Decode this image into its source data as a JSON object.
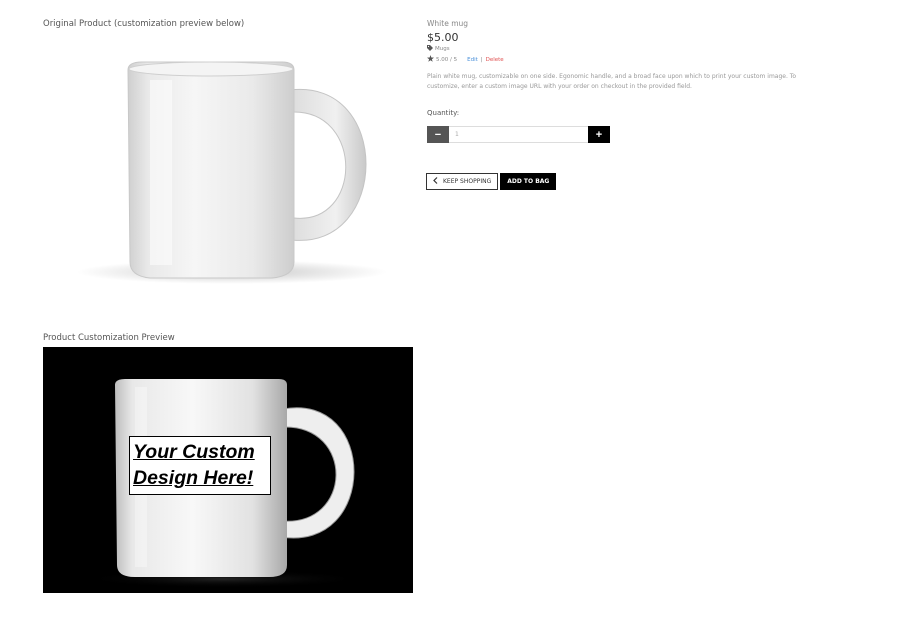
{
  "sections": {
    "original_title": "Original Product (customization preview below)",
    "preview_title": "Product Customization Preview"
  },
  "preview": {
    "overlay_line1": "Your Custom",
    "overlay_line2": "Design Here!"
  },
  "product": {
    "name": "White mug",
    "price": "$5.00",
    "category_icon": "tag-icon",
    "category": "Mugs",
    "rating_icon": "star-icon",
    "rating": "5.00 / 5",
    "edit_label": "Edit",
    "separator": "|",
    "delete_label": "Delete",
    "description": "Plain white mug, customizable on one side. Egonomic handle, and a broad face upon which to print your custom image. To customize, enter a custom image URL with your order on checkout in the provided field."
  },
  "quantity": {
    "label": "Quantity:",
    "value": "1",
    "minus_label": "−",
    "plus_label": "+"
  },
  "actions": {
    "keep_shopping_icon": "chevron-left-icon",
    "keep_shopping": "KEEP SHOPPING",
    "add_to_bag": "ADD TO BAG"
  },
  "colors": {
    "edit_link": "#4a90d9",
    "delete_link": "#e05050",
    "primary_button": "#000000",
    "minus_button": "#555555"
  }
}
